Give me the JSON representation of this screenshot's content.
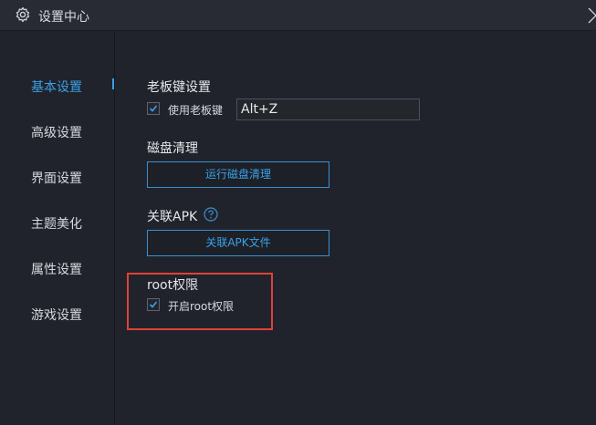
{
  "window": {
    "title": "设置中心"
  },
  "sidebar": {
    "items": [
      {
        "label": "基本设置"
      },
      {
        "label": "高级设置"
      },
      {
        "label": "界面设置"
      },
      {
        "label": "主题美化"
      },
      {
        "label": "属性设置"
      },
      {
        "label": "游戏设置"
      }
    ],
    "active_index": 0
  },
  "boss_key": {
    "title": "老板键设置",
    "checkbox_label": "使用老板键",
    "checked": true,
    "shortcut_value": "Alt+Z"
  },
  "disk_cleanup": {
    "title": "磁盘清理",
    "button_label": "运行磁盘清理"
  },
  "apk_association": {
    "title": "关联APK",
    "help_icon": "question-circle-icon",
    "button_label": "关联APK文件"
  },
  "root_permission": {
    "title": "root权限",
    "checkbox_label": "开启root权限",
    "checked": true
  },
  "colors": {
    "accent": "#3aa0e8",
    "background": "#20232b",
    "highlight": "#e0413a"
  }
}
